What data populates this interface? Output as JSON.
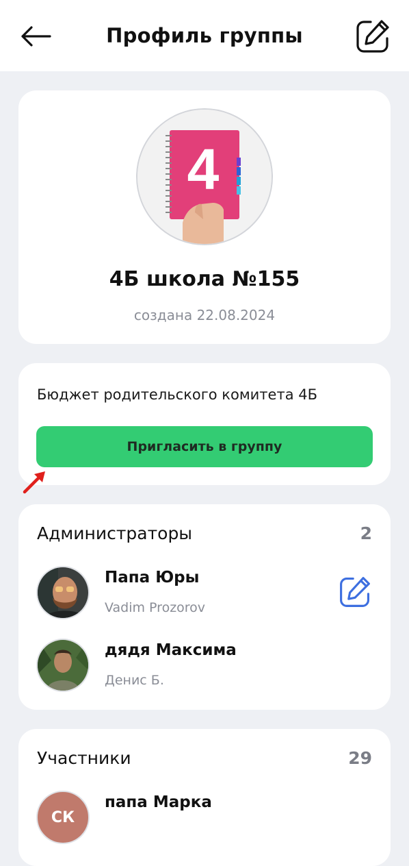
{
  "header": {
    "title": "Профиль группы",
    "back_icon": "arrow-left-icon",
    "edit_icon": "edit-square-icon"
  },
  "group": {
    "name": "4Б школа №155",
    "created": "создана 22.08.2024",
    "avatar_digit": "4"
  },
  "budget": {
    "description": "Бюджет родительского комитета 4Б",
    "invite_label": "Пригласить в группу"
  },
  "admins": {
    "title": "Администраторы",
    "count": "2",
    "items": [
      {
        "name": "Папа Юры",
        "sub": "Vadim Prozorov"
      },
      {
        "name": "дядя Максима",
        "sub": "Денис Б."
      }
    ]
  },
  "members": {
    "title": "Участники",
    "count": "29",
    "items": [
      {
        "name": "папа Марка",
        "initials": "СК"
      }
    ]
  },
  "colors": {
    "accent_green": "#33cc73",
    "edit_blue": "#3d6fe0",
    "annotation_red": "#e0201c",
    "background": "#eef0f4"
  }
}
